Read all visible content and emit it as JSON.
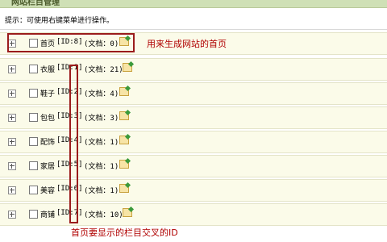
{
  "header": {
    "title": "网站栏目管理"
  },
  "tip": "提示：可使用右键菜单进行操作。",
  "rows": [
    {
      "name": "首页",
      "id_text": "[ID:8]",
      "docs": "(文档：0)"
    },
    {
      "name": "衣服",
      "id_text": "[ID:1]",
      "docs": "(文档：21)"
    },
    {
      "name": "鞋子",
      "id_text": "[ID:2]",
      "docs": "(文档：4)"
    },
    {
      "name": "包包",
      "id_text": "[ID:3]",
      "docs": "(文档：3)"
    },
    {
      "name": "配饰",
      "id_text": "[ID:4]",
      "docs": "(文档：1)"
    },
    {
      "name": "家居",
      "id_text": "[ID:5]",
      "docs": "(文档：1)"
    },
    {
      "name": "美容",
      "id_text": "[ID:6]",
      "docs": "(文档：1)"
    },
    {
      "name": "商铺",
      "id_text": "[ID:7]",
      "docs": "(文档：10)"
    }
  ],
  "annotations": {
    "top_note": "用来生成网站的首页",
    "bottom_note": "首页要显示的栏目交叉的ID"
  },
  "colors": {
    "annotation": "#b00000",
    "highlight_border": "#9b1c1c",
    "row_bg": "#fbfbe9"
  }
}
